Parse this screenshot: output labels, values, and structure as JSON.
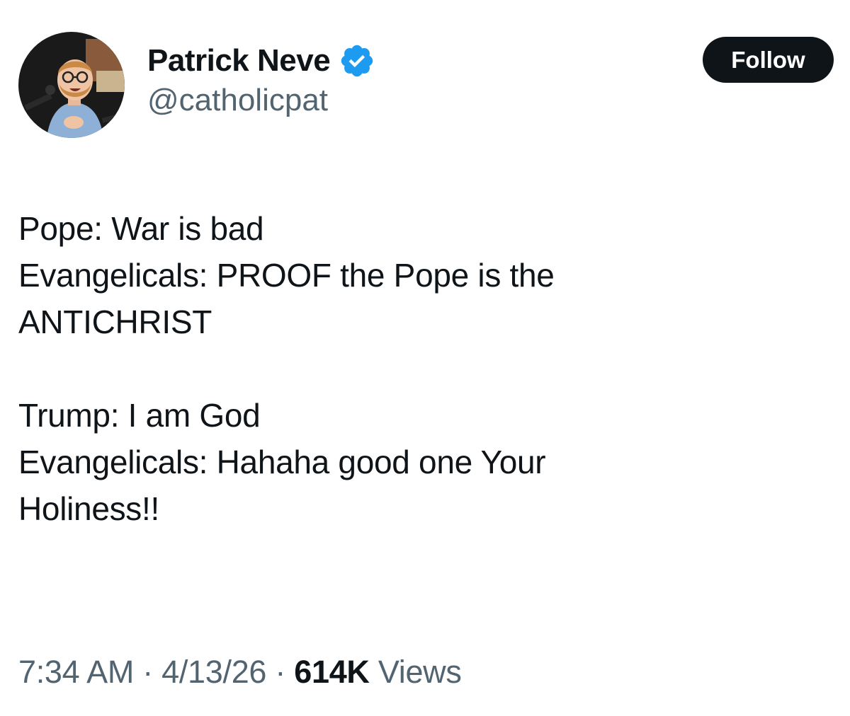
{
  "author": {
    "display_name": "Patrick Neve",
    "handle": "@catholicpat",
    "verified": true
  },
  "follow_button": {
    "label": "Follow"
  },
  "tweet": {
    "lines": [
      "Pope: War is bad",
      "Evangelicals: PROOF the Pope is the",
      "ANTICHRIST",
      "",
      "Trump: I am God",
      "Evangelicals: Hahaha good one Your",
      "Holiness!!"
    ]
  },
  "meta": {
    "time": "7:34 AM",
    "date": "4/13/26",
    "views_count": "614K",
    "views_label": "Views",
    "separator": "·"
  },
  "colors": {
    "verified_badge": "#1d9bf0",
    "secondary_text": "#536471",
    "primary_text": "#0f1419",
    "follow_button_bg": "#0f1419"
  },
  "icons": {
    "verified": "verified-badge-icon"
  }
}
